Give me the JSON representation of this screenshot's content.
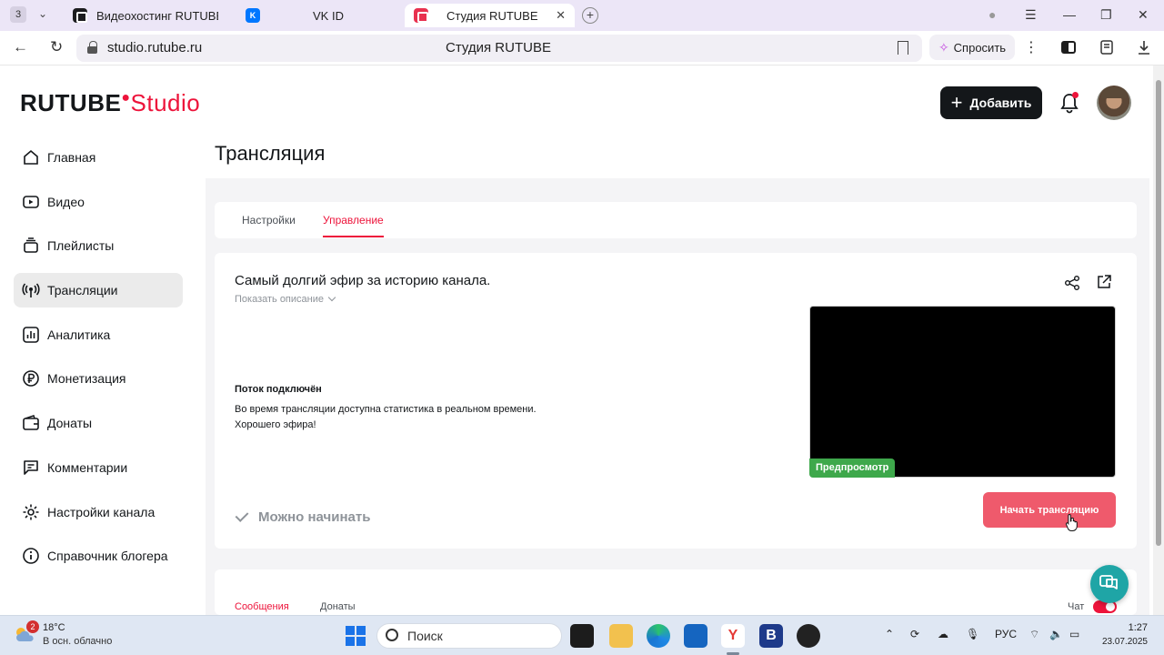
{
  "browser": {
    "tab_count": "3",
    "tabs": [
      {
        "label": "Видеохостинг RUTUBE. С"
      },
      {
        "label": "VK ID"
      },
      {
        "label": "Студия RUTUBE"
      }
    ],
    "url": "studio.rutube.ru",
    "page_title": "Студия RUTUBE",
    "ask_label": "Спросить"
  },
  "header": {
    "logo_part1": "RUTUBE",
    "logo_part2": "Studio",
    "add_label": "Добавить"
  },
  "sidebar": {
    "items": [
      {
        "label": "Главная",
        "icon": "home-icon"
      },
      {
        "label": "Видео",
        "icon": "video-icon"
      },
      {
        "label": "Плейлисты",
        "icon": "playlist-icon"
      },
      {
        "label": "Трансляции",
        "icon": "broadcast-icon",
        "active": true
      },
      {
        "label": "Аналитика",
        "icon": "analytics-icon"
      },
      {
        "label": "Монетизация",
        "icon": "ruble-icon"
      },
      {
        "label": "Донаты",
        "icon": "wallet-icon"
      },
      {
        "label": "Комментарии",
        "icon": "comment-icon"
      },
      {
        "label": "Настройки канала",
        "icon": "gear-icon"
      },
      {
        "label": "Справочник блогера",
        "icon": "info-icon"
      }
    ]
  },
  "main": {
    "title": "Трансляция",
    "tabs": [
      {
        "label": "Настройки"
      },
      {
        "label": "Управление",
        "active": true
      }
    ],
    "broadcast": {
      "title": "Самый долгий эфир за историю канала.",
      "show_description": "Показать описание",
      "status_title": "Поток подключён",
      "status_line1": "Во время трансляции доступна статистика в реальном времени.",
      "status_line2": "Хорошего эфира!",
      "preview_label": "Предпросмотр",
      "ready_label": "Можно начинать",
      "start_button": "Начать трансляцию"
    },
    "chat": {
      "tabs": [
        {
          "label": "Сообщения",
          "active": true
        },
        {
          "label": "Донаты"
        }
      ],
      "chat_label": "Чат",
      "chat_enabled": true
    }
  },
  "taskbar": {
    "notification_count": "2",
    "temperature": "18°C",
    "weather": "В осн. облачно",
    "search_label": "Поиск",
    "language": "РУС",
    "time": "1:27",
    "date": "23.07.2025"
  },
  "colors": {
    "brand": "#ed143b",
    "start_button": "#ef5a6c",
    "preview_badge": "#3ea84b",
    "help_fab": "#1fa5a6"
  }
}
